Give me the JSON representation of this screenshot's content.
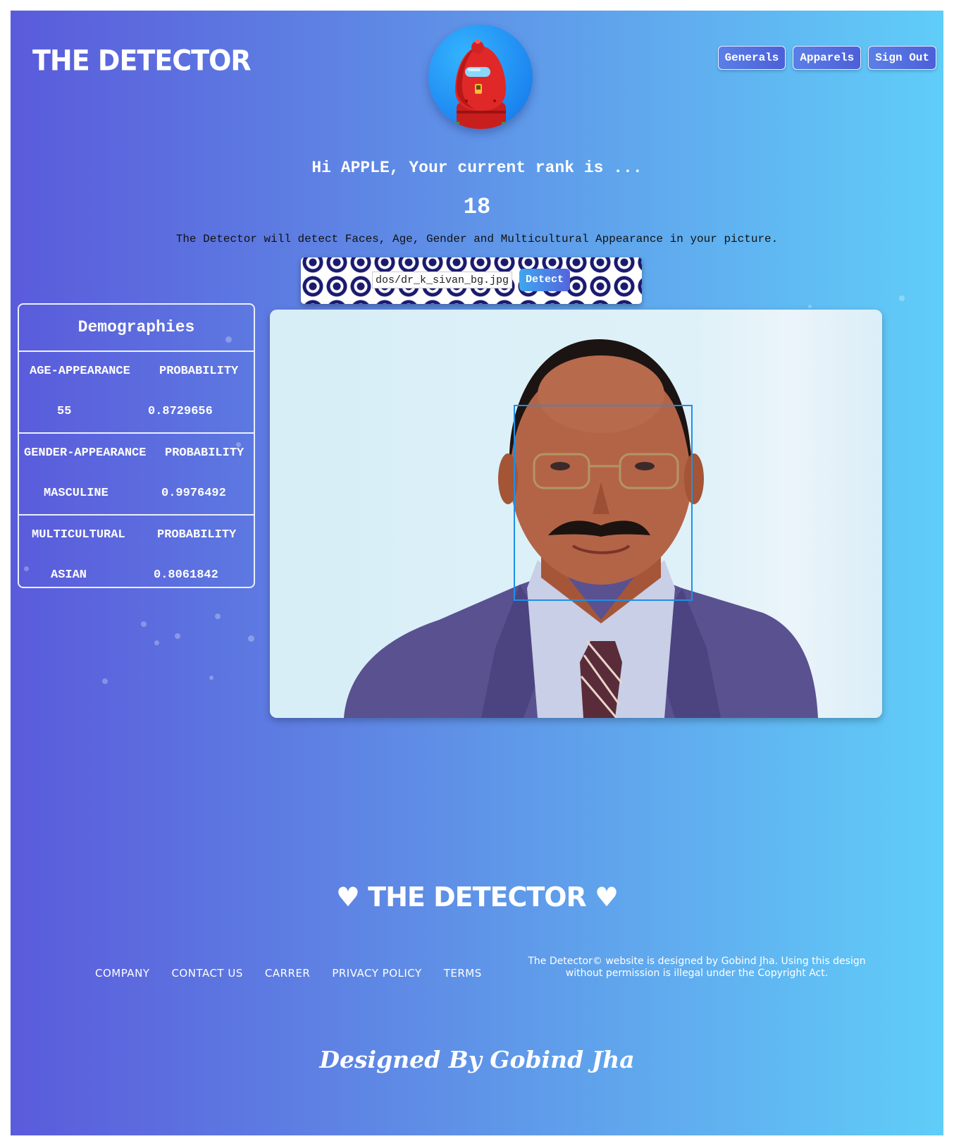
{
  "header": {
    "logo": "THE DETECTOR",
    "nav": [
      "Generals",
      "Apparels",
      "Sign Out"
    ]
  },
  "rank": {
    "greeting": "Hi APPLE, Your current rank is ...",
    "value": "18",
    "description": "The Detector will detect Faces, Age, Gender and Multicultural Appearance in your picture."
  },
  "upload": {
    "file_name": "dos/dr_k_sivan_bg.jpg",
    "detect_label": "Detect"
  },
  "demographies": {
    "title": "Demographies",
    "sections": [
      {
        "label": "AGE-APPEARANCE",
        "prob_label": "PROBABILITY",
        "value": "55",
        "probability": "0.8729656"
      },
      {
        "label": "GENDER-APPEARANCE",
        "prob_label": "PROBABILITY",
        "value": "MASCULINE",
        "probability": "0.9976492"
      },
      {
        "label": "MULTICULTURAL",
        "prob_label": "PROBABILITY",
        "value": "ASIAN",
        "probability": "0.8061842"
      }
    ]
  },
  "footer": {
    "logo": "♥ THE DETECTOR ♥",
    "links": [
      "COMPANY",
      "CONTACT US",
      "CARRER",
      "PRIVACY POLICY",
      "TERMS"
    ],
    "copyright": "The Detector© website is designed by Gobind Jha. Using this design without permission is illegal under the Copyright Act.",
    "signature": "Designed By Gobind Jha"
  },
  "colors": {
    "gradient_start": "#5a5bdb",
    "gradient_end": "#60cdf8",
    "face_box": "#1e90e6"
  },
  "icons": {
    "avatar": "red-crewmate-robot-icon"
  }
}
